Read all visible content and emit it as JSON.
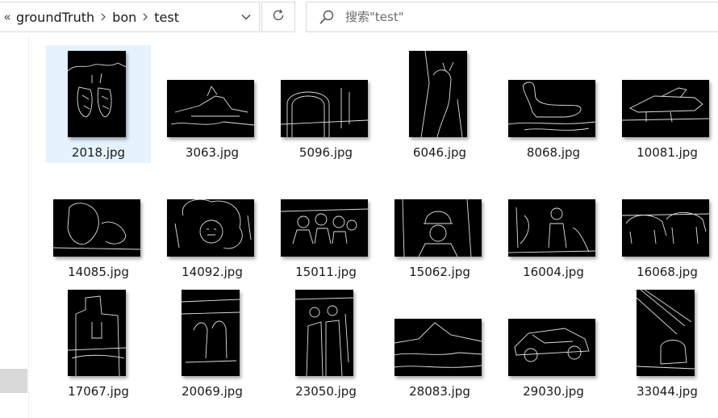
{
  "address_bar": {
    "overflow_glyph": "«",
    "crumbs": [
      "groundTruth",
      "bon",
      "test"
    ]
  },
  "search": {
    "placeholder": "搜索\"test\""
  },
  "icons": {
    "overflow": "double-chevron-left-icon",
    "separator": "chevron-right-icon",
    "dropdown": "chevron-down-icon",
    "refresh": "refresh-icon",
    "search": "search-icon"
  },
  "colors": {
    "selected_tile": "#e5f3ff",
    "thumb_bg": "#000000",
    "edge": "#dcdcdc"
  },
  "files": [
    {
      "name": "2018.jpg",
      "orientation": "portrait",
      "selected": true
    },
    {
      "name": "3063.jpg",
      "orientation": "landscape",
      "selected": false
    },
    {
      "name": "5096.jpg",
      "orientation": "landscape",
      "selected": false
    },
    {
      "name": "6046.jpg",
      "orientation": "portrait",
      "selected": false
    },
    {
      "name": "8068.jpg",
      "orientation": "landscape",
      "selected": false
    },
    {
      "name": "10081.jpg",
      "orientation": "landscape",
      "selected": false
    },
    {
      "name": "14085.jpg",
      "orientation": "landscape",
      "selected": false
    },
    {
      "name": "14092.jpg",
      "orientation": "landscape",
      "selected": false
    },
    {
      "name": "15011.jpg",
      "orientation": "landscape",
      "selected": false
    },
    {
      "name": "15062.jpg",
      "orientation": "landscape",
      "selected": false
    },
    {
      "name": "16004.jpg",
      "orientation": "landscape",
      "selected": false
    },
    {
      "name": "16068.jpg",
      "orientation": "landscape",
      "selected": false
    },
    {
      "name": "17067.jpg",
      "orientation": "portrait",
      "selected": false
    },
    {
      "name": "20069.jpg",
      "orientation": "portrait",
      "selected": false
    },
    {
      "name": "23050.jpg",
      "orientation": "portrait",
      "selected": false
    },
    {
      "name": "28083.jpg",
      "orientation": "landscape",
      "selected": false
    },
    {
      "name": "29030.jpg",
      "orientation": "landscape",
      "selected": false
    },
    {
      "name": "33044.jpg",
      "orientation": "portrait",
      "selected": false
    }
  ]
}
